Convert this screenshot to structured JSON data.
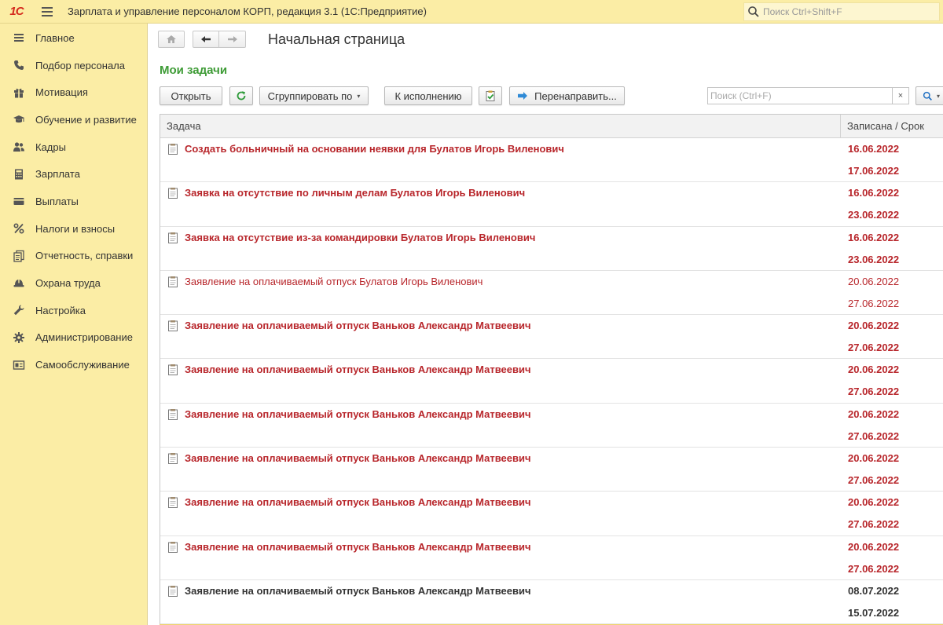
{
  "app": {
    "logo": "1С",
    "title": "Зарплата и управление персоналом КОРП, редакция 3.1  (1С:Предприятие)",
    "search_placeholder": "Поиск Ctrl+Shift+F"
  },
  "sidebar": {
    "items": [
      {
        "label": "Главное",
        "icon": "menu-lines-icon"
      },
      {
        "label": "Подбор персонала",
        "icon": "phone-icon"
      },
      {
        "label": "Мотивация",
        "icon": "gift-icon"
      },
      {
        "label": "Обучение и развитие",
        "icon": "graduation-cap-icon"
      },
      {
        "label": "Кадры",
        "icon": "people-icon"
      },
      {
        "label": "Зарплата",
        "icon": "calculator-icon"
      },
      {
        "label": "Выплаты",
        "icon": "card-icon"
      },
      {
        "label": "Налоги и взносы",
        "icon": "percent-icon"
      },
      {
        "label": "Отчетность, справки",
        "icon": "documents-icon"
      },
      {
        "label": "Охрана труда",
        "icon": "helmet-icon"
      },
      {
        "label": "Настройка",
        "icon": "wrench-icon"
      },
      {
        "label": "Администрирование",
        "icon": "gear-icon"
      },
      {
        "label": "Самообслуживание",
        "icon": "id-card-icon"
      }
    ]
  },
  "page": {
    "title": "Начальная страница",
    "section_title": "Мои задачи"
  },
  "toolbar": {
    "open_label": "Открыть",
    "group_by_label": "Сгруппировать по",
    "execute_label": "К исполнению",
    "redirect_label": "Перенаправить...",
    "search_placeholder": "Поиск (Ctrl+F)",
    "clear_label": "×"
  },
  "table": {
    "columns": {
      "task": "Задача",
      "date": "Записана / Срок"
    },
    "rows": [
      {
        "title": "Создать больничный на основании неявки для Булатов Игорь Виленович",
        "recorded": "16.06.2022",
        "due": "17.06.2022",
        "style": "red-bold"
      },
      {
        "title": "Заявка на отсутствие по личным делам Булатов Игорь Виленович",
        "recorded": "16.06.2022",
        "due": "23.06.2022",
        "style": "red-bold"
      },
      {
        "title": "Заявка на отсутствие из-за командировки Булатов Игорь Виленович",
        "recorded": "16.06.2022",
        "due": "23.06.2022",
        "style": "red-bold"
      },
      {
        "title": "Заявление на оплачиваемый отпуск Булатов Игорь Виленович",
        "recorded": "20.06.2022",
        "due": "27.06.2022",
        "style": "red-plain"
      },
      {
        "title": "Заявление на оплачиваемый отпуск Ваньков Александр Матвеевич",
        "recorded": "20.06.2022",
        "due": "27.06.2022",
        "style": "red-bold"
      },
      {
        "title": "Заявление на оплачиваемый отпуск Ваньков Александр Матвеевич",
        "recorded": "20.06.2022",
        "due": "27.06.2022",
        "style": "red-bold"
      },
      {
        "title": "Заявление на оплачиваемый отпуск Ваньков Александр Матвеевич",
        "recorded": "20.06.2022",
        "due": "27.06.2022",
        "style": "red-bold"
      },
      {
        "title": "Заявление на оплачиваемый отпуск Ваньков Александр Матвеевич",
        "recorded": "20.06.2022",
        "due": "27.06.2022",
        "style": "red-bold"
      },
      {
        "title": "Заявление на оплачиваемый отпуск Ваньков Александр Матвеевич",
        "recorded": "20.06.2022",
        "due": "27.06.2022",
        "style": "red-bold"
      },
      {
        "title": "Заявление на оплачиваемый отпуск Ваньков Александр Матвеевич",
        "recorded": "20.06.2022",
        "due": "27.06.2022",
        "style": "red-bold"
      },
      {
        "title": "Заявление на оплачиваемый отпуск Ваньков Александр Матвеевич",
        "recorded": "08.07.2022",
        "due": "15.07.2022",
        "style": "dark-bold"
      }
    ]
  },
  "colors": {
    "panel_yellow": "#fbeda5",
    "overdue_red": "#b8262b",
    "section_green": "#3d9b35"
  }
}
